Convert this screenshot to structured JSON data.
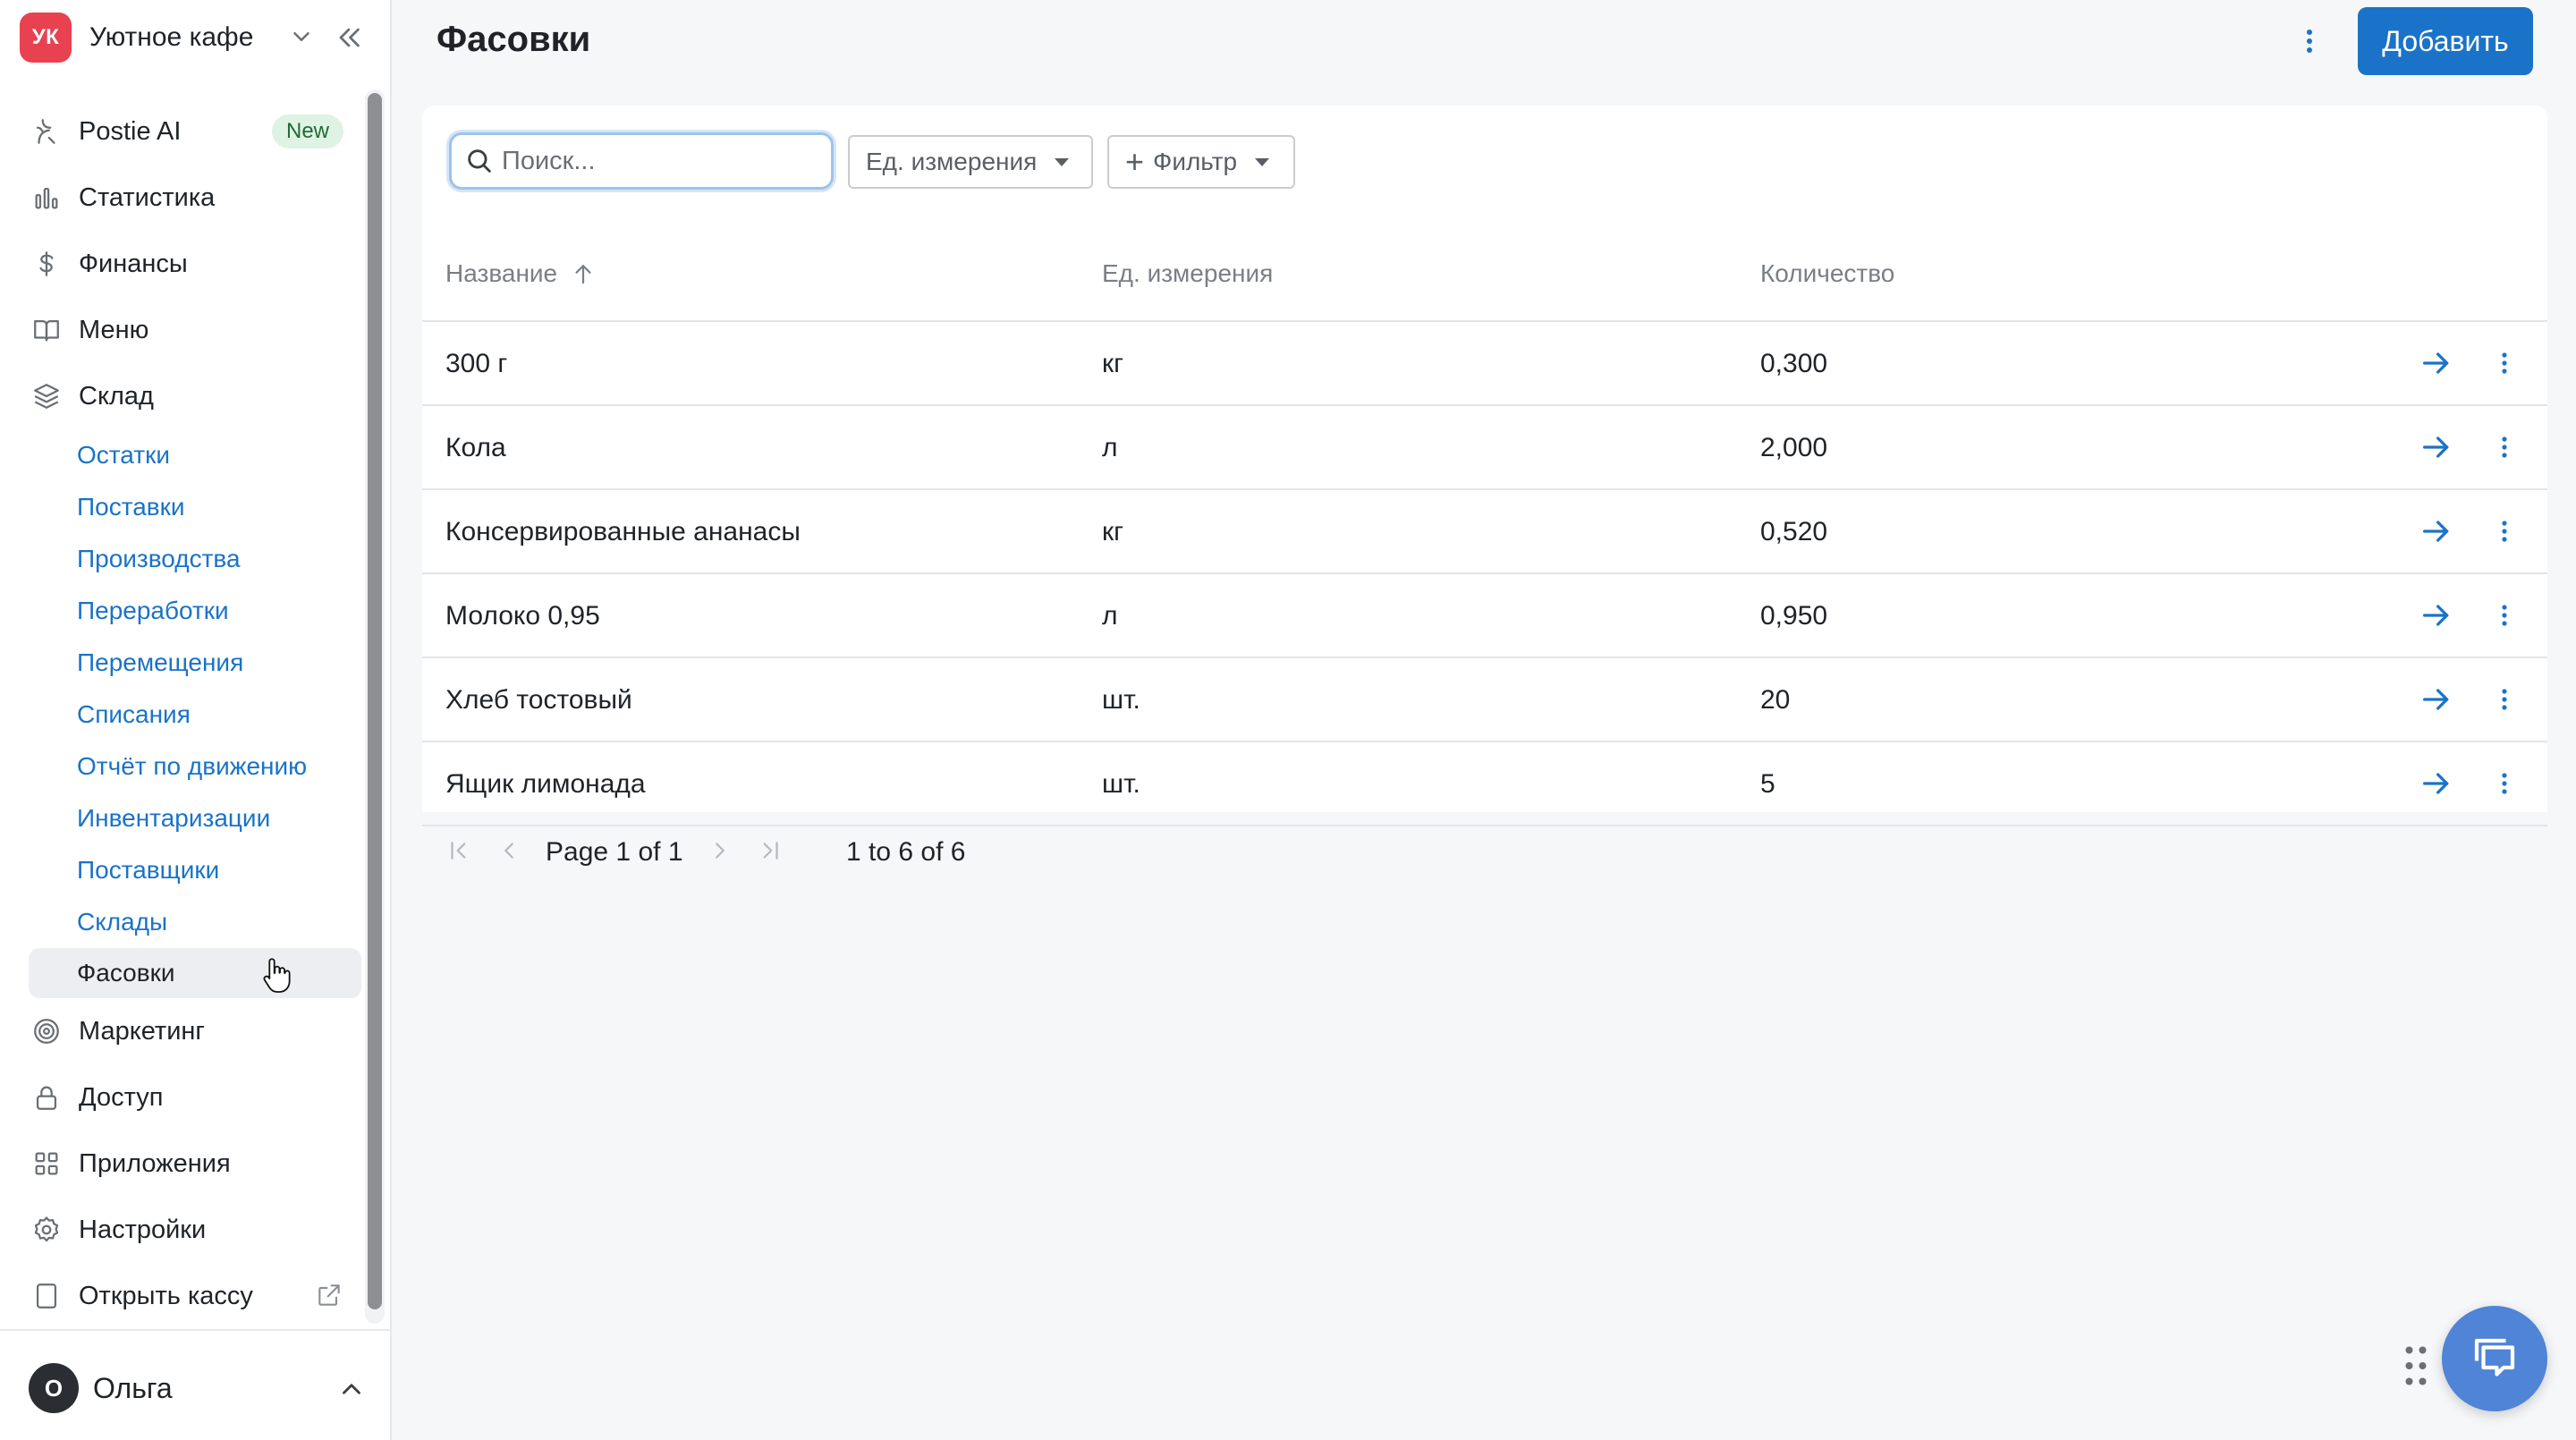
{
  "org": {
    "initials": "УК",
    "name": "Уютное кафе"
  },
  "nav": {
    "postie": {
      "label": "Postie AI",
      "badge": "New"
    },
    "stats": "Статистика",
    "finance": "Финансы",
    "menu": "Меню",
    "warehouse": "Склад",
    "warehouse_sub": [
      "Остатки",
      "Поставки",
      "Производства",
      "Переработки",
      "Перемещения",
      "Списания",
      "Отчёт по движению",
      "Инвентаризации",
      "Поставщики",
      "Склады",
      "Фасовки"
    ],
    "marketing": "Маркетинг",
    "access": "Доступ",
    "apps": "Приложения",
    "settings": "Настройки",
    "open_register": "Открыть кассу"
  },
  "user": {
    "initial": "О",
    "name": "Ольга"
  },
  "page": {
    "title": "Фасовки",
    "add_label": "Добавить"
  },
  "toolbar": {
    "search_placeholder": "Поиск...",
    "unit_filter": "Ед. измерения",
    "filter_label": "Фильтр"
  },
  "table": {
    "columns": [
      "Название",
      "Ед. измерения",
      "Количество"
    ],
    "rows": [
      [
        "300 г",
        "кг",
        "0,300"
      ],
      [
        "Кола",
        "л",
        "2,000"
      ],
      [
        "Консервированные ананасы",
        "кг",
        "0,520"
      ],
      [
        "Молоко 0,95",
        "л",
        "0,950"
      ],
      [
        "Хлеб тостовый",
        "шт.",
        "20"
      ],
      [
        "Ящик лимонада",
        "шт.",
        "5"
      ]
    ]
  },
  "pager": {
    "page_word": "Page",
    "current": "1",
    "of_word": "of",
    "total": "1",
    "range": "1 to 6 of 6"
  },
  "colors": {
    "accent": "#1a73c8",
    "brand": "#e8414f",
    "fab": "#4f84d6"
  }
}
